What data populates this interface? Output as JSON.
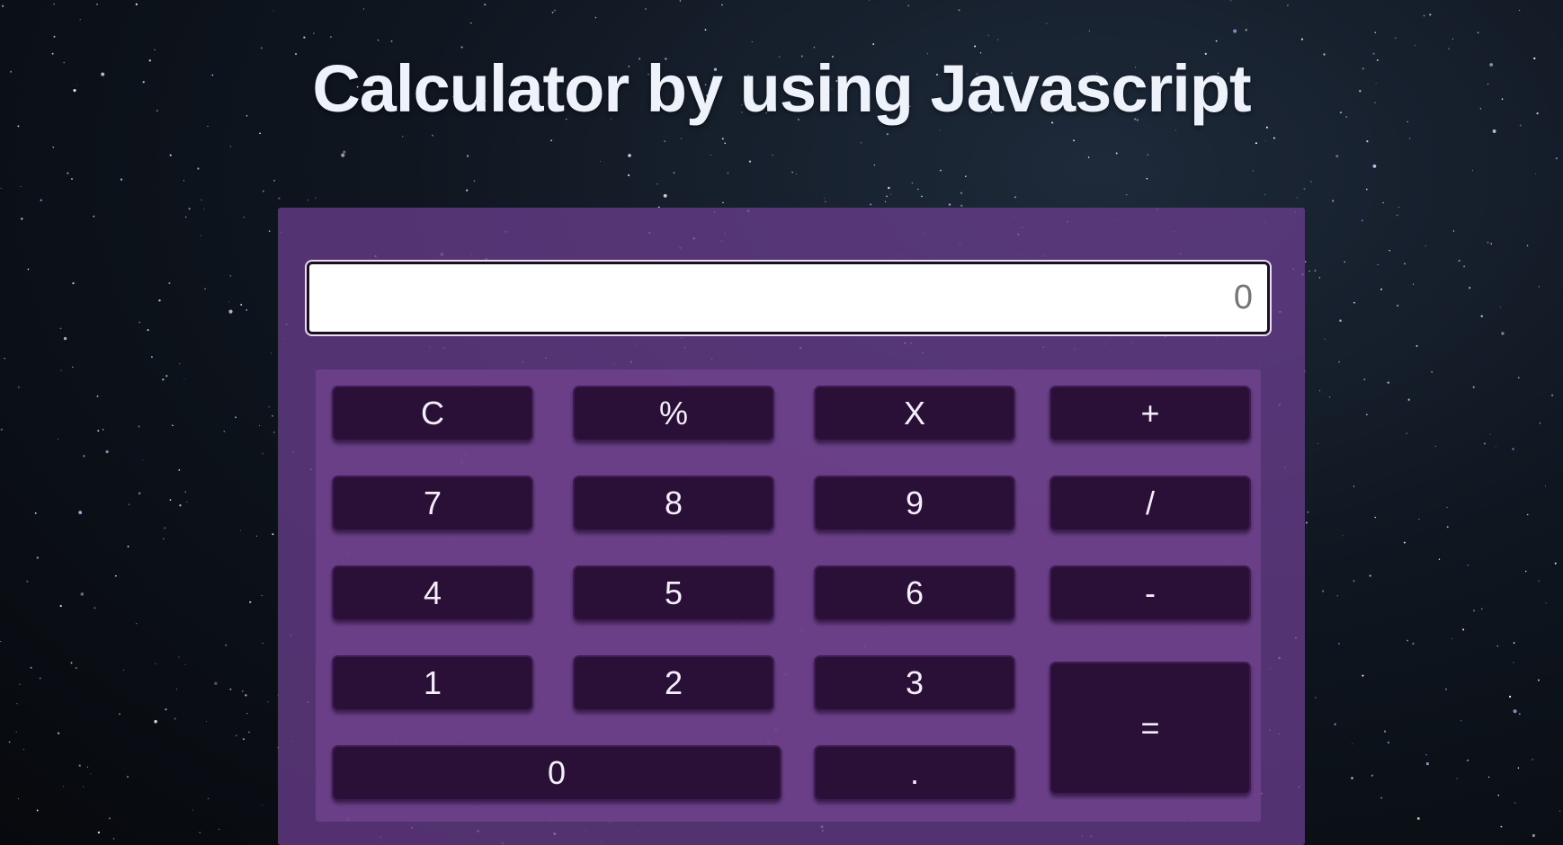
{
  "page": {
    "title": "Calculator by using Javascript"
  },
  "display": {
    "value": "",
    "placeholder": "0"
  },
  "keys": {
    "clear": "C",
    "percent": "%",
    "multiply": "X",
    "add": "+",
    "seven": "7",
    "eight": "8",
    "nine": "9",
    "divide": "/",
    "four": "4",
    "five": "5",
    "six": "6",
    "subtract": "-",
    "one": "1",
    "two": "2",
    "three": "3",
    "equals": "=",
    "zero": "0",
    "decimal": "."
  },
  "colors": {
    "panel": "#683c8a",
    "key": "#2a0f36",
    "key_text": "#f4eefa",
    "title": "#eef2fb",
    "background": "#07090d"
  }
}
